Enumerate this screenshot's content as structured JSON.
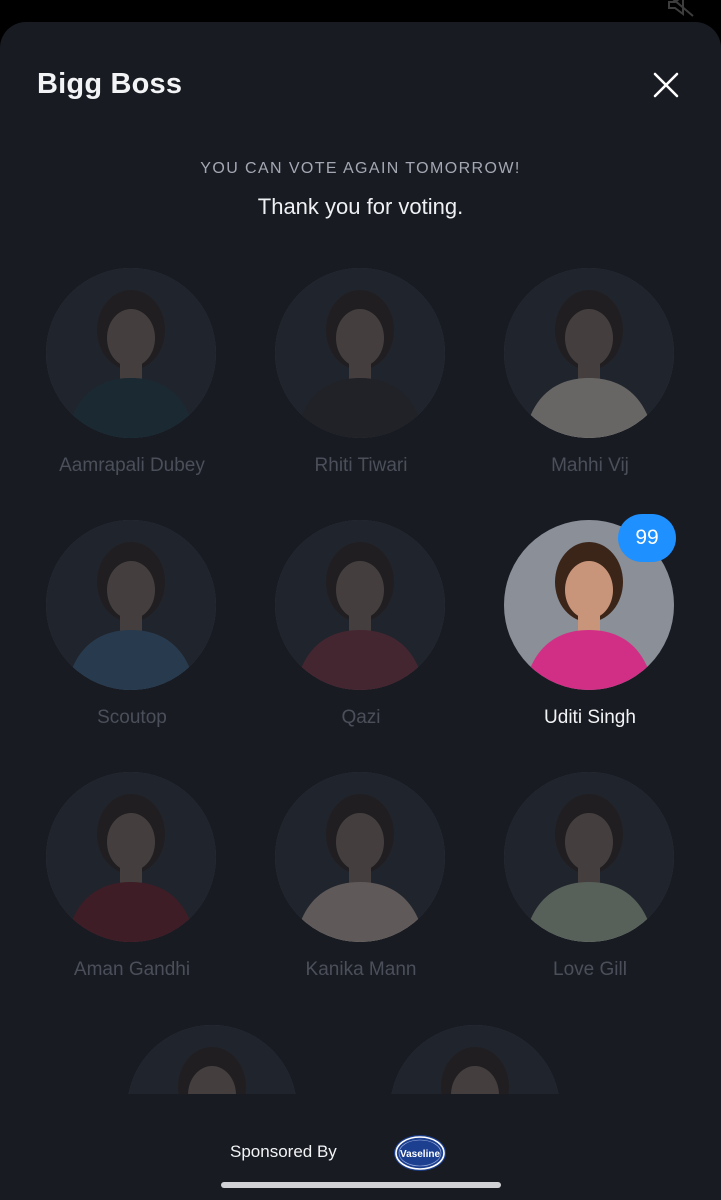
{
  "header": {
    "title": "Bigg Boss",
    "close_icon": "close-icon"
  },
  "vote_status": {
    "notice": "YOU CAN VOTE AGAIN TOMORROW!",
    "message": "Thank you for voting."
  },
  "contestants": [
    {
      "name": "Aamrapali Dubey",
      "selected": false,
      "outfit": "#1d3a45"
    },
    {
      "name": "Rhiti Tiwari",
      "selected": false,
      "outfit": "#2b2b2e"
    },
    {
      "name": "Mahhi Vij",
      "selected": false,
      "outfit": "#c9c2b5"
    },
    {
      "name": "Scoutop",
      "selected": false,
      "outfit": "#3c6080"
    },
    {
      "name": "Qazi",
      "selected": false,
      "outfit": "#7a3340"
    },
    {
      "name": "Uditi Singh",
      "selected": true,
      "votes": "99",
      "outfit": "#d12f86"
    },
    {
      "name": "Aman Gandhi",
      "selected": false,
      "outfit": "#6d1f2a"
    },
    {
      "name": "Kanika Mann",
      "selected": false,
      "outfit": "#b7a79b"
    },
    {
      "name": "Love Gill",
      "selected": false,
      "outfit": "#a5b59e"
    },
    {
      "name": "",
      "selected": false,
      "outfit": "#222226"
    },
    {
      "name": "",
      "selected": false,
      "outfit": "#3a2f2d"
    }
  ],
  "footer": {
    "sponsor_label": "Sponsored By",
    "sponsor_logo_text": "Vaseline"
  },
  "colors": {
    "badge": "#1e90ff",
    "background": "#181b22",
    "brand_blue": "#1c3f8f"
  }
}
